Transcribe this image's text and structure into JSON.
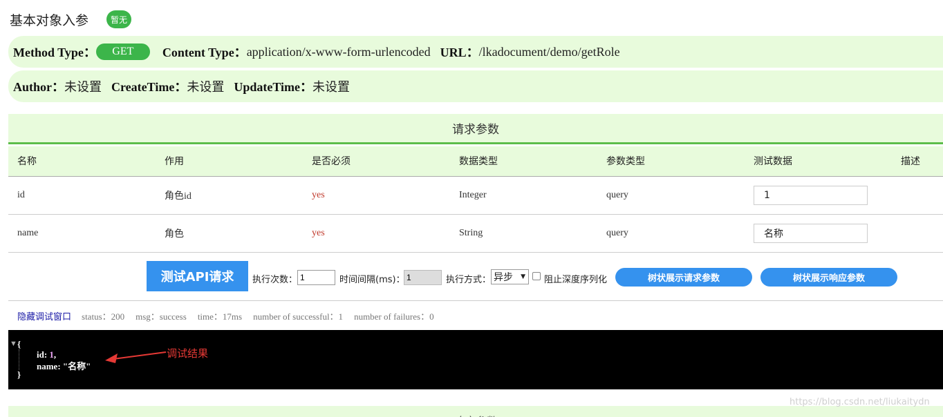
{
  "header": {
    "title": "基本对象入参",
    "badge": "暂无"
  },
  "meta": {
    "method_label": "Method Type：",
    "method": "GET",
    "content_type_label": "Content Type：",
    "content_type": "application/x-www-form-urlencoded",
    "url_label": "URL：",
    "url": "/lkadocument/demo/getRole",
    "author_label": "Author：",
    "author": "未设置",
    "create_label": "CreateTime：",
    "create_time": "未设置",
    "update_label": "UpdateTime：",
    "update_time": "未设置"
  },
  "request_params": {
    "title": "请求参数",
    "columns": [
      "名称",
      "作用",
      "是否必须",
      "数据类型",
      "参数类型",
      "测试数据",
      "描述"
    ],
    "rows": [
      {
        "name": "id",
        "role": "角色id",
        "required": "yes",
        "data_type": "Integer",
        "param_type": "query",
        "test_value": "1"
      },
      {
        "name": "name",
        "role": "角色",
        "required": "yes",
        "data_type": "String",
        "param_type": "query",
        "test_value": "名称"
      }
    ]
  },
  "controls": {
    "test_button": "测试API请求",
    "exec_count_label": "执行次数：",
    "exec_count": "1",
    "interval_label": "时间间隔(ms)：",
    "interval": "1",
    "mode_label": "执行方式：",
    "mode": "异步",
    "no_deep_label": "阻止深度序列化",
    "tree_request_button": "树状展示请求参数",
    "tree_response_button": "树状展示响应参数"
  },
  "status": {
    "hide_link": "隐藏调试窗口",
    "status": "status：200",
    "msg": "msg：success",
    "time": "time：17ms",
    "successful": "number of successful：1",
    "failures": "number of failures：0"
  },
  "console": {
    "open_brace": "{",
    "key1": "id: ",
    "val1": "1",
    "comma1": ",",
    "key2": "name: ",
    "val2": "\"名称\"",
    "close_brace": "}"
  },
  "annotation": {
    "text": "调试结果",
    "color": "#e53935"
  },
  "response_params": {
    "title": "响应参数"
  },
  "watermark": "https://blog.csdn.net/liukaitydn",
  "colors": {
    "accent_green": "#3cb54a",
    "light_green": "#e8fbdc",
    "button_blue": "#3592ee",
    "required_red": "#c0392b"
  }
}
